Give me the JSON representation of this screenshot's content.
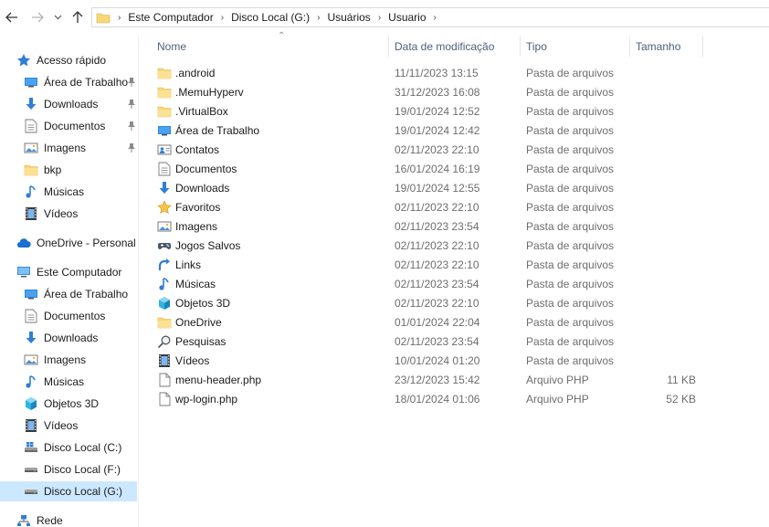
{
  "address_bar": {
    "crumbs": [
      "Este Computador",
      "Disco Local (G:)",
      "Usuários",
      "Usuario"
    ]
  },
  "sidebar": {
    "quick_access": "Acesso rápido",
    "quick_items": [
      {
        "label": "Área de Trabalho",
        "icon": "desktop-icon",
        "pinned": true
      },
      {
        "label": "Downloads",
        "icon": "download-icon",
        "pinned": true
      },
      {
        "label": "Documentos",
        "icon": "document-icon",
        "pinned": true
      },
      {
        "label": "Imagens",
        "icon": "image-icon",
        "pinned": true
      },
      {
        "label": "bkp",
        "icon": "folder-icon",
        "pinned": false
      },
      {
        "label": "Músicas",
        "icon": "music-icon",
        "pinned": false
      },
      {
        "label": "Vídeos",
        "icon": "video-icon",
        "pinned": false
      }
    ],
    "onedrive": "OneDrive - Personal",
    "this_pc": "Este Computador",
    "pc_items": [
      {
        "label": "Área de Trabalho",
        "icon": "desktop-icon"
      },
      {
        "label": "Documentos",
        "icon": "document-icon"
      },
      {
        "label": "Downloads",
        "icon": "download-icon"
      },
      {
        "label": "Imagens",
        "icon": "image-icon"
      },
      {
        "label": "Músicas",
        "icon": "music-icon"
      },
      {
        "label": "Objetos 3D",
        "icon": "cube-icon"
      },
      {
        "label": "Vídeos",
        "icon": "video-icon"
      },
      {
        "label": "Disco Local (C:)",
        "icon": "windows-drive-icon"
      },
      {
        "label": "Disco Local (F:)",
        "icon": "drive-icon"
      },
      {
        "label": "Disco Local (G:)",
        "icon": "drive-icon",
        "selected": true
      }
    ],
    "network": "Rede"
  },
  "columns": {
    "name": "Nome",
    "date": "Data de modificação",
    "type": "Tipo",
    "size": "Tamanho"
  },
  "files": [
    {
      "name": ".android",
      "date": "11/11/2023 13:15",
      "type": "Pasta de arquivos",
      "size": "",
      "icon": "folder-icon"
    },
    {
      "name": ".MemuHyperv",
      "date": "31/12/2023 16:08",
      "type": "Pasta de arquivos",
      "size": "",
      "icon": "folder-icon"
    },
    {
      "name": ".VirtualBox",
      "date": "19/01/2024 12:52",
      "type": "Pasta de arquivos",
      "size": "",
      "icon": "folder-icon"
    },
    {
      "name": "Área de Trabalho",
      "date": "19/01/2024 12:42",
      "type": "Pasta de arquivos",
      "size": "",
      "icon": "desktop-icon"
    },
    {
      "name": "Contatos",
      "date": "02/11/2023 22:10",
      "type": "Pasta de arquivos",
      "size": "",
      "icon": "contacts-icon"
    },
    {
      "name": "Documentos",
      "date": "16/01/2024 16:19",
      "type": "Pasta de arquivos",
      "size": "",
      "icon": "document-icon"
    },
    {
      "name": "Downloads",
      "date": "19/01/2024 12:55",
      "type": "Pasta de arquivos",
      "size": "",
      "icon": "download-icon"
    },
    {
      "name": "Favoritos",
      "date": "02/11/2023 22:10",
      "type": "Pasta de arquivos",
      "size": "",
      "icon": "star-icon"
    },
    {
      "name": "Imagens",
      "date": "02/11/2023 23:54",
      "type": "Pasta de arquivos",
      "size": "",
      "icon": "image-icon"
    },
    {
      "name": "Jogos Salvos",
      "date": "02/11/2023 22:10",
      "type": "Pasta de arquivos",
      "size": "",
      "icon": "gamepad-icon"
    },
    {
      "name": "Links",
      "date": "02/11/2023 22:10",
      "type": "Pasta de arquivos",
      "size": "",
      "icon": "link-arrow-icon"
    },
    {
      "name": "Músicas",
      "date": "02/11/2023 23:54",
      "type": "Pasta de arquivos",
      "size": "",
      "icon": "music-icon"
    },
    {
      "name": "Objetos 3D",
      "date": "02/11/2023 22:10",
      "type": "Pasta de arquivos",
      "size": "",
      "icon": "cube-icon"
    },
    {
      "name": "OneDrive",
      "date": "01/01/2024 22:04",
      "type": "Pasta de arquivos",
      "size": "",
      "icon": "folder-icon"
    },
    {
      "name": "Pesquisas",
      "date": "02/11/2023 23:54",
      "type": "Pasta de arquivos",
      "size": "",
      "icon": "search-icon"
    },
    {
      "name": "Vídeos",
      "date": "10/01/2024 01:20",
      "type": "Pasta de arquivos",
      "size": "",
      "icon": "video-icon"
    },
    {
      "name": "menu-header.php",
      "date": "23/12/2023 15:42",
      "type": "Arquivo PHP",
      "size": "11 KB",
      "icon": "file-icon"
    },
    {
      "name": "wp-login.php",
      "date": "18/01/2024 01:06",
      "type": "Arquivo PHP",
      "size": "52 KB",
      "icon": "file-icon"
    }
  ],
  "colors": {
    "selection": "#cce8ff",
    "folder": "#f8d775",
    "accent_blue": "#2f7ed8",
    "header_text": "#4c607a",
    "secondary_text": "#6d6d6d"
  }
}
